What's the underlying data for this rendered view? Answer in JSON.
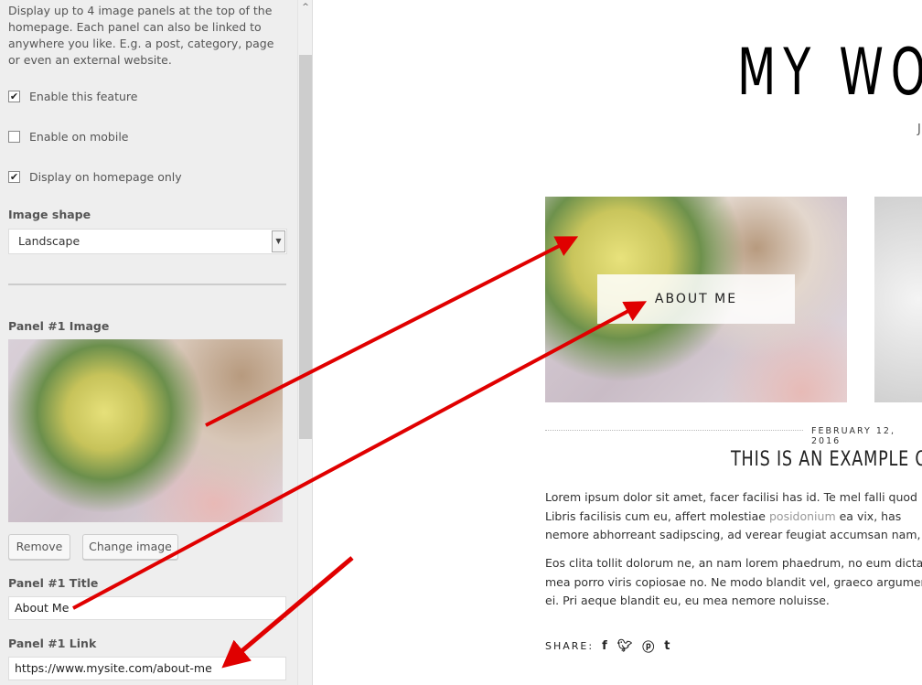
{
  "customizer": {
    "description": "Display up to 4 image panels at the top of the homepage. Each panel can also be linked to anywhere you like. E.g. a post, category, page or even an external website.",
    "checkboxes": [
      {
        "label": "Enable this feature",
        "checked": true
      },
      {
        "label": "Enable on mobile",
        "checked": false
      },
      {
        "label": "Display on homepage only",
        "checked": true
      }
    ],
    "image_shape_label": "Image shape",
    "image_shape_value": "Landscape",
    "panel_image_label": "Panel #1 Image",
    "remove_label": "Remove",
    "change_image_label": "Change image",
    "panel_title_label": "Panel #1 Title",
    "panel_title_value": "About Me",
    "panel_link_label": "Panel #1 Link",
    "panel_link_value": "https://www.mysite.com/about-me"
  },
  "preview": {
    "site_title": "MY WO",
    "tagline": "J",
    "panel_caption": "ABOUT ME",
    "post_date": "FEBRUARY 12, 2016",
    "post_title": "THIS IS AN EXAMPLE OF",
    "para1": [
      "Lorem ipsum dolor sit amet, facer facilisi has id. Te mel falli quod",
      "Libris facilisis cum eu, affert molestiae ",
      "posidonium",
      " ea vix, has",
      "nemore abhorreant sadipscing, ad verear feugiat accumsan nam,"
    ],
    "para2": [
      "Eos clita tollit dolorum ne, an nam lorem phaedrum, no eum dicta",
      "mea porro viris copiosae no. Ne modo blandit vel, graeco argumen",
      "ei. Pri aeque blandit eu, eu mea nemore noluisse."
    ],
    "share_label": "SHARE:",
    "share_icons": [
      "facebook-icon",
      "twitter-icon",
      "pinterest-icon",
      "tumblr-icon"
    ]
  },
  "colors": {
    "arrow": "#e00000",
    "link": "#999999"
  }
}
